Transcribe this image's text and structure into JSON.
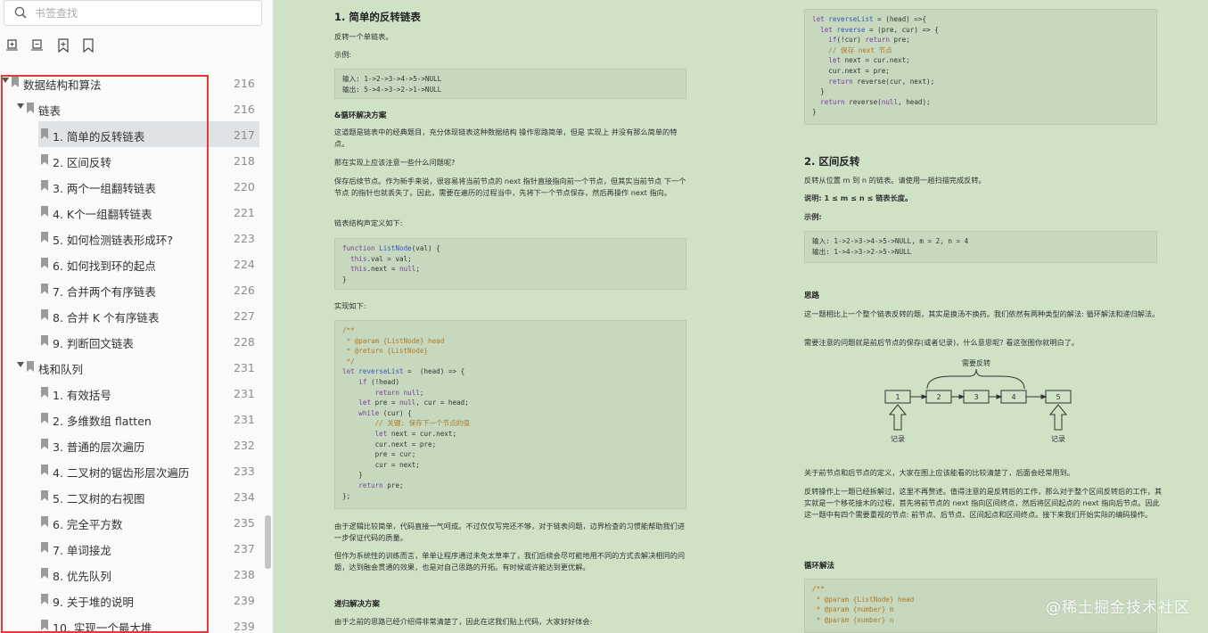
{
  "search": {
    "placeholder": "书签查找"
  },
  "toolbar": [
    "expand-all-icon",
    "collapse-all-icon",
    "add-bookmark-icon",
    "bookmark-icon"
  ],
  "tree": [
    {
      "label": "数据结构和算法",
      "page": "216",
      "level": 0
    },
    {
      "label": "链表",
      "page": "216",
      "level": 1
    },
    {
      "label": "1. 简单的反转链表",
      "page": "217",
      "level": 2,
      "selected": true
    },
    {
      "label": "2. 区间反转",
      "page": "218",
      "level": 2
    },
    {
      "label": "3. 两个一组翻转链表",
      "page": "220",
      "level": 2
    },
    {
      "label": "4. K个一组翻转链表",
      "page": "221",
      "level": 2
    },
    {
      "label": "5. 如何检测链表形成环?",
      "page": "223",
      "level": 2
    },
    {
      "label": "6. 如何找到环的起点",
      "page": "224",
      "level": 2
    },
    {
      "label": "7. 合并两个有序链表",
      "page": "226",
      "level": 2
    },
    {
      "label": "8. 合并 K 个有序链表",
      "page": "227",
      "level": 2
    },
    {
      "label": "9. 判断回文链表",
      "page": "228",
      "level": 2
    },
    {
      "label": "栈和队列",
      "page": "231",
      "level": 1
    },
    {
      "label": "1. 有效括号",
      "page": "231",
      "level": 2
    },
    {
      "label": "2. 多维数组 flatten",
      "page": "231",
      "level": 2
    },
    {
      "label": "3. 普通的层次遍历",
      "page": "232",
      "level": 2
    },
    {
      "label": "4. 二叉树的锯齿形层次遍历",
      "page": "233",
      "level": 2
    },
    {
      "label": "5. 二叉树的右视图",
      "page": "234",
      "level": 2
    },
    {
      "label": "6. 完全平方数",
      "page": "235",
      "level": 2
    },
    {
      "label": "7. 单词接龙",
      "page": "237",
      "level": 2
    },
    {
      "label": "8. 优先队列",
      "page": "238",
      "level": 2
    },
    {
      "label": "9. 关于堆的说明",
      "page": "239",
      "level": 2
    },
    {
      "label": "10. 实现一个最大堆",
      "page": "239",
      "level": 2
    }
  ],
  "left_page": {
    "title": "1. 简单的反转链表",
    "p1": "反转一个单链表。",
    "p2": "示例:",
    "example": "输入: 1->2->3->4->5->NULL\n输出: 5->4->3->2->1->NULL",
    "h_loop": "&循环解决方案",
    "p3": "这道题是链表中的经典题目，充分体现链表这种数据结构 操作思路简单，但是 实现上 并没有那么简单的特点。",
    "p4": "那在实现上应该注意一些什么问题呢?",
    "p5": "保存后续节点。作为新手来说，很容易将当前节点的 next 指针直接指向前一个节点，但其实当前节点 下一个节点 的指针也就丢失了。因此，需要在遍历的过程当中，先将下一个节点保存，然后再操作 next 指向。",
    "p6": "链表结构声定义如下:",
    "p7": "实现如下:",
    "p8": "由于逻辑比较简单，代码直接一气呵成。不过仅仅写完还不够，对于链表问题，边界检查的习惯能帮助我们进一步保证代码的质量。",
    "p9": "但作为系统性的训练而言，单单让程序通过未免太草率了，我们后续会尽可能地用不同的方式去解决相同的问题，达到融会贯通的效果，也是对自己思路的开拓。有时候或许能达到更优解。",
    "h_rec": "递归解决方案",
    "p10": "由于之前的思路已经介绍得非常清楚了，因此在这我们贴上代码，大家好好体会:"
  },
  "right_page": {
    "title": "2. 区间反转",
    "p1": "反转从位置 m 到 n 的链表。请使用一趟扫描完成反转。",
    "p2": "说明: 1 ≤ m ≤ n ≤ 链表长度。",
    "p3": "示例:",
    "example": "输入: 1->2->3->4->5->NULL, m = 2, n = 4\n输出: 1->4->3->2->5->NULL",
    "h_idea": "思路",
    "p4": "这一题相比上一个整个链表反转的题，其实是换汤不换药。我们依然有两种类型的解法: 循环解法和递归解法。",
    "p5": "需要注意的问题就是前后节点的保存(或者记录)，什么意思呢? 看这张图你就明白了。",
    "diagram": {
      "need_reverse": "需要反转",
      "nodes": [
        "1",
        "2",
        "3",
        "4",
        "5"
      ],
      "record": "记录"
    },
    "p6": "关于前节点和后节点的定义，大家在图上应该能看的比较清楚了，后面会经常用到。",
    "p7": "反转操作上一题已经拆解过，这里不再赘述。值得注意的是反转后的工作，那么对于整个区间反转后的工作，其实就是一个移花接木的过程，首先将前节点的 next 指向区间终点，然后将区间起点的 next 指向后节点。因此这一题中有四个需要重视的节点: 前节点、后节点、区间起点和区间终点。接下来我们开始实际的编码操作。",
    "h_loop": "循环解法"
  },
  "watermark": "@稀土掘金技术社区"
}
